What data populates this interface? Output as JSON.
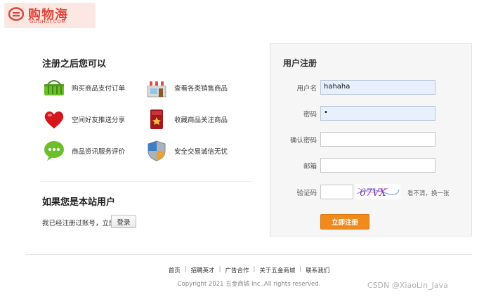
{
  "logo": {
    "name": "购物海",
    "sub": "GOUHAI.COM"
  },
  "benefits": {
    "title": "注册之后您可以",
    "items": [
      {
        "label": "购买商品支付订单",
        "icon": "shopping-basket-icon"
      },
      {
        "label": "查看各类销售商品",
        "icon": "store-icon"
      },
      {
        "label": "空间好友推送分享",
        "icon": "heart-icon"
      },
      {
        "label": "收藏商品关注商品",
        "icon": "bookmark-card-icon"
      },
      {
        "label": "商品资讯服务评价",
        "icon": "chat-bubble-icon"
      },
      {
        "label": "安全交易诚信无忧",
        "icon": "shield-icon"
      }
    ]
  },
  "member": {
    "title": "如果您是本站用户",
    "text": "我已经注册过账号，立即",
    "login_label": "登录"
  },
  "register": {
    "title": "用户注册",
    "username_label": "用户名",
    "username_value": "hahaha",
    "password_label": "密码",
    "password_value": "•",
    "confirm_label": "确认密码",
    "email_label": "邮箱",
    "captcha_label": "验证码",
    "captcha_text": "67VX",
    "captcha_tip": "看不清，换一张",
    "submit_label": "立即注册"
  },
  "footer": {
    "links": [
      "首页",
      "招聘英才",
      "广告合作",
      "关于五金商城",
      "联系我们"
    ],
    "copyright": "Copyright 2021 五金商城 Inc.,All rights reserved."
  },
  "watermark": "CSDN @XiaoLin_Java",
  "colors": {
    "brand": "#e0463b",
    "submit": "#f08a1c"
  }
}
